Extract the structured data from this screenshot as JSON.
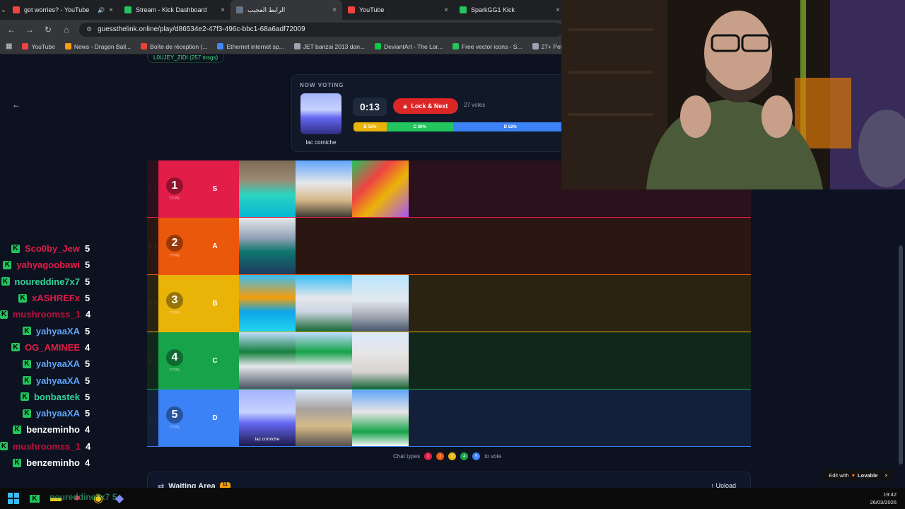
{
  "browser": {
    "tabs": [
      {
        "title": "got worries? - YouTube",
        "fav": "#ef4444",
        "extra": "🔊",
        "active": false
      },
      {
        "title": "Stream - Kick Dashboard",
        "fav": "#22c55e",
        "active": false
      },
      {
        "title": "الرابط العجيب",
        "fav": "#64748b",
        "active": true
      },
      {
        "title": "YouTube",
        "fav": "#ef4444",
        "active": false
      },
      {
        "title": "SparkGG1 Kick",
        "fav": "#22c55e",
        "active": false
      }
    ],
    "url": "guessthelink.online/play/d86534e2-47f3-496c-bbc1-68a6adf72009",
    "bookmarks": [
      {
        "label": "YouTube",
        "color": "#ef4444"
      },
      {
        "label": "News - Dragon Ball...",
        "color": "#f59e0b"
      },
      {
        "label": "Boîte de réception (...",
        "color": "#ea4335"
      },
      {
        "label": "Ethernet internet sp...",
        "color": "#4285f4"
      },
      {
        "label": "JET banzai 2013 dan...",
        "color": "#9ca3af"
      },
      {
        "label": "DeviantArt - The Lar...",
        "color": "#05cc47"
      },
      {
        "label": "Free vector icons - S...",
        "color": "#22c55e"
      },
      {
        "label": "27+ Pet Pictures | D...",
        "color": "#9ca3af"
      }
    ]
  },
  "page": {
    "user_pill": "L0UJEY_ZIDI (257 msgs)",
    "voting": {
      "label": "NOW VOTING",
      "item": "lac corniche",
      "timer": "0:13",
      "lock_button": "Lock & Next",
      "votes": "27 votes",
      "bar": [
        {
          "label": "B 15%",
          "pct": 15,
          "color": "#eab308"
        },
        {
          "label": "C 30%",
          "pct": 30,
          "color": "#22c55e"
        },
        {
          "label": "D 52%",
          "pct": 52,
          "color": "#3b82f6"
        }
      ]
    },
    "tiers": [
      {
        "num": "1",
        "type": "TYPE",
        "grade": "S",
        "color": "#e11d48",
        "row": "#2a111b",
        "images": [
          {
            "bg": "linear-gradient(180deg,#7c6a55 0%,#9b8b74 35%,#2dd4bf 60%,#06b6d4 100%)"
          },
          {
            "bg": "linear-gradient(180deg,#60a5fa 0%,#e5e7eb 40%,#d6b98a 70%,#3f3a33 100%)"
          },
          {
            "bg": "linear-gradient(135deg,#22c55e 0%,#ef4444 35%,#eab308 60%,#a855f7 100%)"
          }
        ]
      },
      {
        "num": "2",
        "type": "TYPE",
        "grade": "A",
        "color": "#ea580c",
        "row": "#2a1712",
        "images": [
          {
            "bg": "linear-gradient(180deg,#e5e7eb 0%,#94a3b8 35%,#0f766e 60%,#1e3a5f 100%)"
          }
        ]
      },
      {
        "num": "3",
        "type": "TYPE",
        "grade": "B",
        "color": "#eab308",
        "row": "#2a2312",
        "images": [
          {
            "bg": "linear-gradient(180deg,#38bdf8 0%,#f59e0b 40%,#0ea5e9 65%,#22d3ee 100%)"
          },
          {
            "bg": "linear-gradient(180deg,#38bdf8 0%,#e5e7eb 40%,#cbd5e1 65%,#166534 100%)"
          },
          {
            "bg": "linear-gradient(180deg,#bae6fd 0%,#e2e8f0 45%,#9ca3af 75%,#475569 100%)"
          }
        ]
      },
      {
        "num": "4",
        "type": "TYPE",
        "grade": "C",
        "color": "#16a34a",
        "row": "#12271b",
        "images": [
          {
            "bg": "linear-gradient(180deg,#bfdbfe 0%,#15803d 35%,#e5e7eb 60%,#4b5563 100%)"
          },
          {
            "bg": "linear-gradient(180deg,#bfdbfe 0%,#16a34a 35%,#e5e7eb 60%,#4b5563 100%)"
          },
          {
            "bg": "linear-gradient(180deg,#dbeafe 0%,#e7e5e4 40%,#d6d3d1 70%,#166534 100%)"
          }
        ]
      },
      {
        "num": "5",
        "type": "TYPE",
        "grade": "D",
        "color": "#3b82f6",
        "row": "#141f3a",
        "images": [
          {
            "bg": "linear-gradient(180deg,#a5b4fc 0%,#c7d2fe 40%,#6366f1 60%,#1e1b4b 100%)",
            "caption": "lac corniche"
          },
          {
            "bg": "linear-gradient(180deg,#dbeafe 0%,#a8a29e 35%,#d6b98a 65%,#57534e 100%)"
          },
          {
            "bg": "linear-gradient(180deg,#60a5fa 0%,#e7e5e4 40%,#16a34a 75%,#f5f5f4 100%)"
          }
        ]
      }
    ],
    "chat_types": {
      "prefix": "Chat types",
      "suffix": "to vote",
      "digits": [
        "1",
        "2",
        "3",
        "4",
        "5"
      ]
    },
    "waiting": {
      "title": "Waiting Area",
      "badge": "11",
      "upload": "Upload"
    },
    "edit_with": "Edit with",
    "lovable": "Lovable"
  },
  "chat": [
    {
      "user": "Sco0by_Jew",
      "color": "#e11d48",
      "vote": "5"
    },
    {
      "user": "yahyagoobawi",
      "color": "#e11d48",
      "vote": "5"
    },
    {
      "user": "noureddine7x7",
      "color": "#34d399",
      "vote": "5"
    },
    {
      "user": "xASHREFx",
      "color": "#e11d48",
      "vote": "5"
    },
    {
      "user": "mushroomss_1",
      "color": "#be123c",
      "vote": "4"
    },
    {
      "user": "yahyaaXA",
      "color": "#60a5fa",
      "vote": "5"
    },
    {
      "user": "OG_AMINEE",
      "color": "#e11d48",
      "vote": "4"
    },
    {
      "user": "yahyaaXA",
      "color": "#60a5fa",
      "vote": "5"
    },
    {
      "user": "yahyaaXA",
      "color": "#60a5fa",
      "vote": "5"
    },
    {
      "user": "bonbastek",
      "color": "#34d399",
      "vote": "5"
    },
    {
      "user": "yahyaaXA",
      "color": "#60a5fa",
      "vote": "5"
    },
    {
      "user": "benzeminho",
      "color": "#ffffff",
      "vote": "4"
    },
    {
      "user": "mushroomss_1",
      "color": "#be123c",
      "vote": "4"
    },
    {
      "user": "benzeminho",
      "color": "#ffffff",
      "vote": "4"
    }
  ],
  "taskbar": {
    "time": "19:42",
    "date": "26/03/2026",
    "overlay_text": "noureddine7x7 5"
  }
}
